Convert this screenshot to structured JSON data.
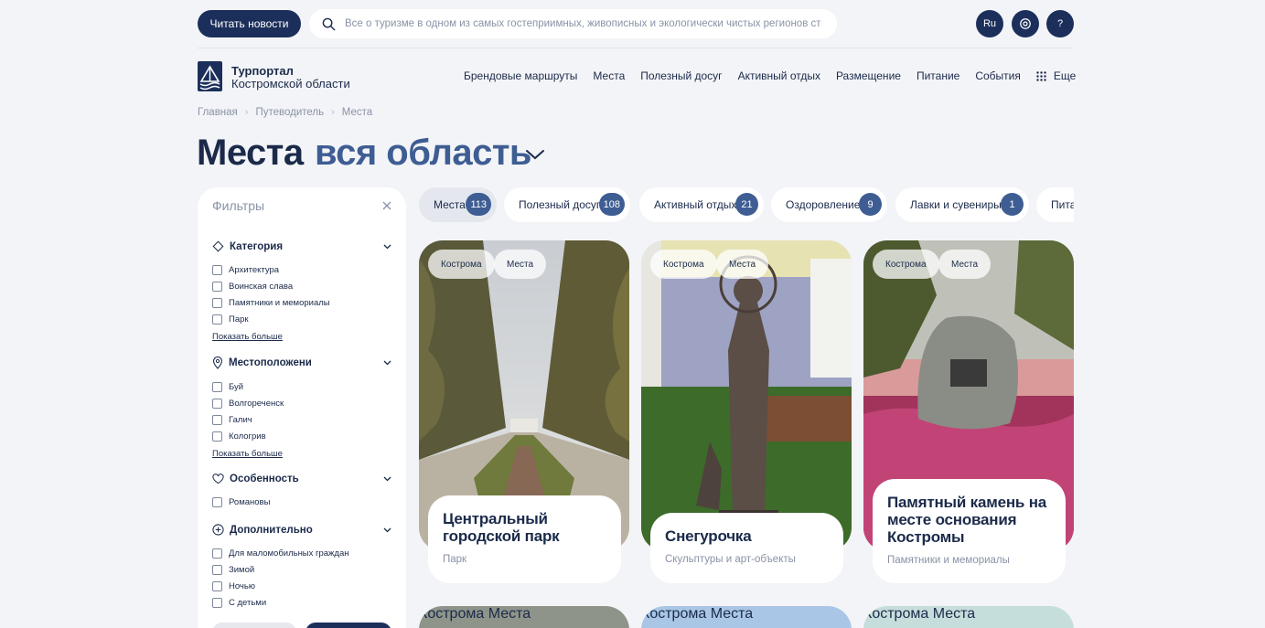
{
  "topbar": {
    "news_label": "Читать новости",
    "search_placeholder": "Все о туризме в одном из самых гостеприимных, живописных и экологически чистых регионов страны",
    "lang_label": "Ru",
    "help_label": "?"
  },
  "brand": {
    "title": "Турпортал",
    "subtitle": "Костромской области"
  },
  "nav": {
    "items": [
      "Брендовые маршруты",
      "Места",
      "Полезный досуг",
      "Активный отдых",
      "Размещение",
      "Питание",
      "События"
    ],
    "more_label": "Еще"
  },
  "breadcrumbs": [
    "Главная",
    "Путеводитель",
    "Места"
  ],
  "page": {
    "title": "Места",
    "region": "вся область"
  },
  "filters": {
    "title": "Фильтры",
    "groups": [
      {
        "label": "Категория",
        "icon": "diamond-icon",
        "options": [
          "Архитектура",
          "Воинская слава",
          "Памятники и мемориалы",
          "Парк"
        ],
        "show_more": "Показать больше"
      },
      {
        "label": "Местоположени",
        "icon": "pin-icon",
        "options": [
          "Буй",
          "Волгореченск",
          "Галич",
          "Кологрив"
        ],
        "show_more": "Показать больше"
      },
      {
        "label": "Особенность",
        "icon": "heart-icon",
        "options": [
          "Романовы"
        ]
      },
      {
        "label": "Дополнительно",
        "icon": "plus-circle-icon",
        "options": [
          "Для маломобильных граждан",
          "Зимой",
          "Ночью",
          "С детьми"
        ]
      }
    ]
  },
  "chips": [
    {
      "label": "Места",
      "count": "113"
    },
    {
      "label": "Полезный досуг",
      "count": "108"
    },
    {
      "label": "Активный отдых",
      "count": "21"
    },
    {
      "label": "Оздоровление",
      "count": "9"
    },
    {
      "label": "Лавки и сувениры",
      "count": "1"
    },
    {
      "label": "Питание",
      "count": ""
    }
  ],
  "cards": [
    {
      "tags": [
        "Кострома",
        "Места"
      ],
      "title": "Центральный городской парк",
      "subtitle": "Парк"
    },
    {
      "tags": [
        "Кострома",
        "Места"
      ],
      "title": "Снегурочка",
      "subtitle": "Скульптуры и арт-объекты"
    },
    {
      "tags": [
        "Кострома",
        "Места"
      ],
      "title": "Памятный камень на месте основания Костромы",
      "subtitle": "Памятники и мемориалы"
    }
  ],
  "colors": {
    "primary": "#1c2f5b",
    "accent": "#3e5d93",
    "background": "#f3f4f7"
  }
}
